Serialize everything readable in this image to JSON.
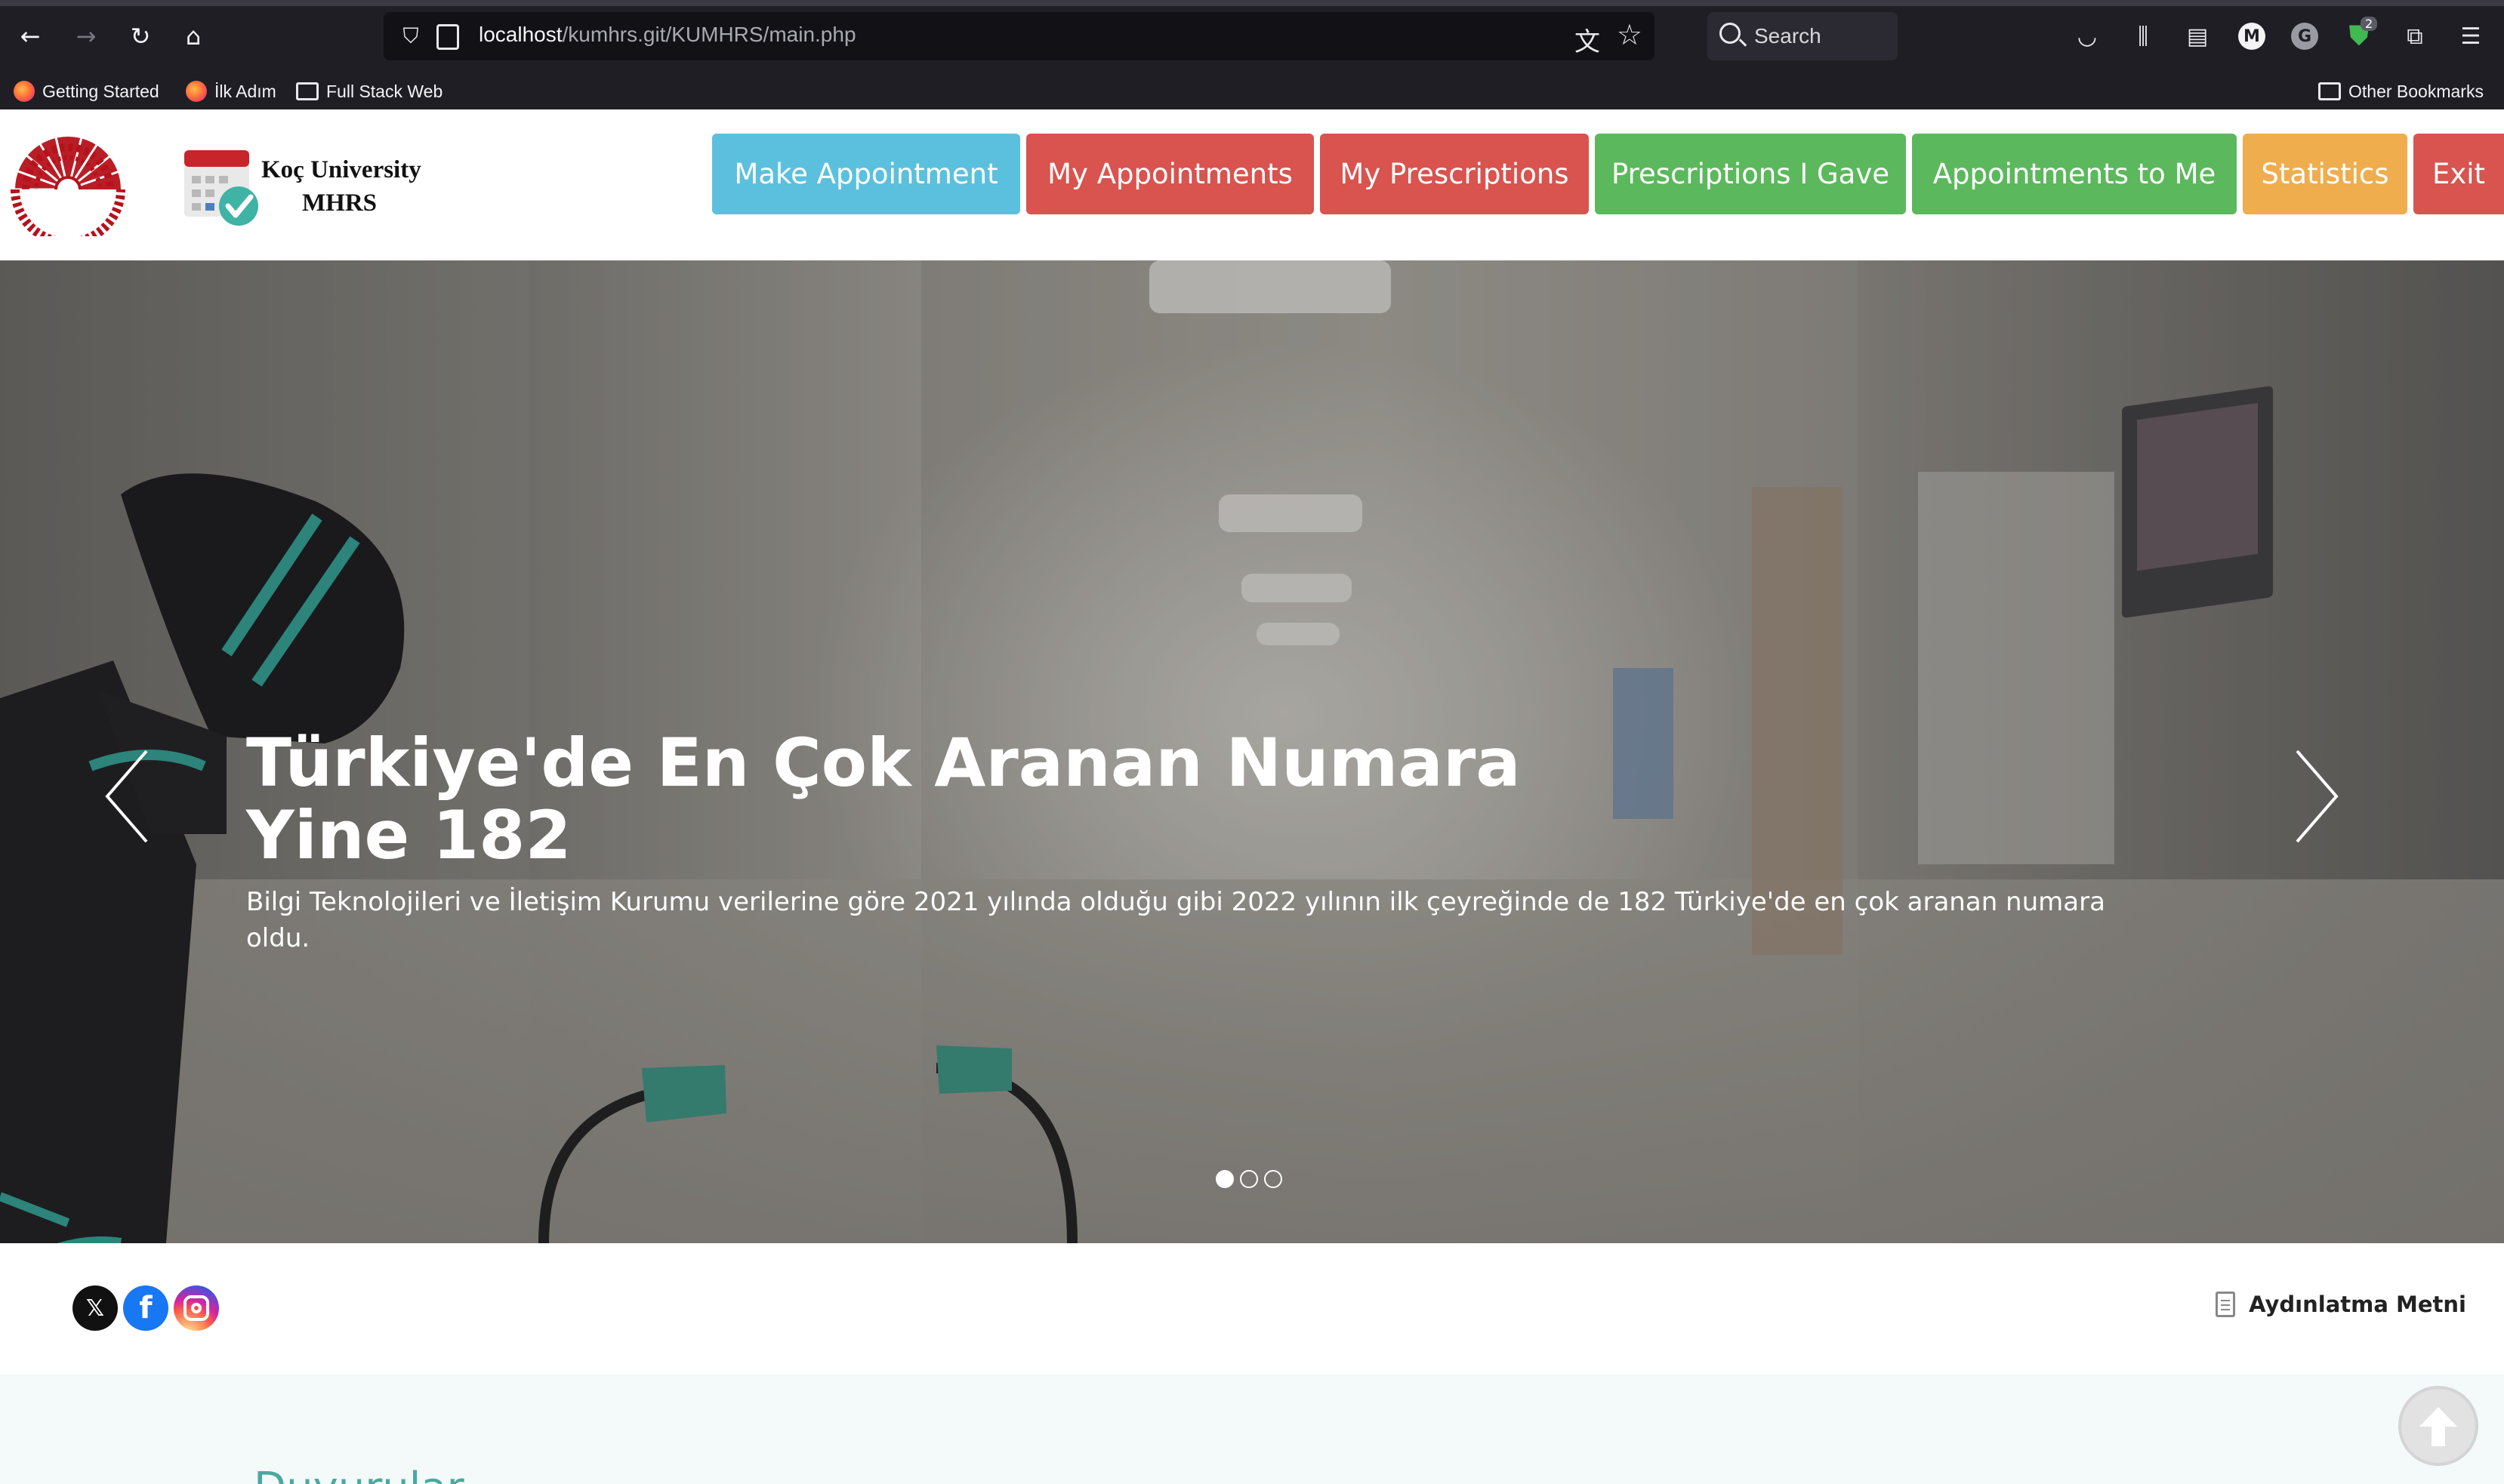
{
  "browser": {
    "url_host": "localhost",
    "url_path": "/kumhrs.git/KUMHRS/main.php",
    "search_placeholder": "Search",
    "extension_badge": "2",
    "profile_letter": "M",
    "bookmarks": [
      {
        "label": "Getting Started",
        "icon": "firefox-icon"
      },
      {
        "label": "İlk Adım",
        "icon": "firefox-icon"
      },
      {
        "label": "Full Stack Web",
        "icon": "folder-icon"
      }
    ],
    "other_bookmarks": "Other Bookmarks"
  },
  "header": {
    "brand_line1": "Koç University",
    "brand_line2": "MHRS",
    "nav": [
      {
        "label": "Make Appointment",
        "style": "info",
        "color": "#5bc0de"
      },
      {
        "label": "My Appointments",
        "style": "danger",
        "color": "#d9534f"
      },
      {
        "label": "My Prescriptions",
        "style": "danger",
        "color": "#d9534f"
      },
      {
        "label": "Prescriptions I Gave",
        "style": "success",
        "color": "#5cb85c"
      },
      {
        "label": "Appointments to Me",
        "style": "success",
        "color": "#5cb85c"
      },
      {
        "label": "Statistics",
        "style": "warning",
        "color": "#f0ad4e"
      },
      {
        "label": "Exit",
        "style": "danger",
        "color": "#d9534f"
      }
    ]
  },
  "carousel": {
    "title_line1": "Türkiye'de En Çok Aranan Numara",
    "title_line2": "Yine 182",
    "text": "Bilgi Teknolojileri ve İletişim Kurumu verilerine göre 2021 yılında olduğu gibi 2022 yılının ilk çeyreğinde de 182 Türkiye'de en çok aranan numara oldu.",
    "slide_count": 3,
    "active_slide": 1
  },
  "footer_strip": {
    "social": [
      "x-icon",
      "facebook-icon",
      "instagram-icon"
    ],
    "aydinlatma_label": "Aydınlatma Metni"
  },
  "announcements": {
    "title": "Duyurular"
  },
  "colors": {
    "brand_red": "#b5121b",
    "accent_teal": "#4aa8a0"
  }
}
